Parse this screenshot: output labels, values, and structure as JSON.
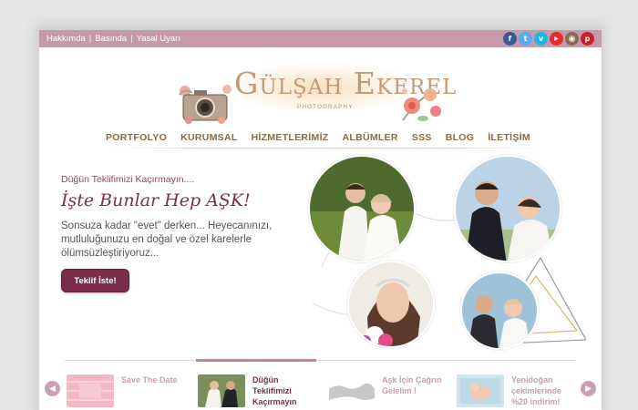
{
  "topbar": {
    "links": [
      "Hakkımda",
      "Basında",
      "Yasal Uyarı"
    ],
    "separator": "|",
    "socials": [
      {
        "name": "facebook-icon",
        "glyph": "f",
        "color": "#3b5998"
      },
      {
        "name": "twitter-icon",
        "glyph": "t",
        "color": "#55acee"
      },
      {
        "name": "vimeo-icon",
        "glyph": "v",
        "color": "#1ab7ea"
      },
      {
        "name": "youtube-icon",
        "glyph": "▶",
        "color": "#e52d27"
      },
      {
        "name": "instagram-icon",
        "glyph": "◉",
        "color": "#8a6a4f"
      },
      {
        "name": "pinterest-icon",
        "glyph": "p",
        "color": "#cb2027"
      }
    ]
  },
  "logo": {
    "title": "Gülşah Ekerel",
    "subtitle": "PHOTOGRAPHY"
  },
  "nav": [
    "PORTFOLYO",
    "KURUMSAL",
    "HİZMETLERİMİZ",
    "ALBÜMLER",
    "SSS",
    "BLOG",
    "İLETİŞİM"
  ],
  "hero": {
    "kicker": "Düğün Teklifimizi Kaçırmayın....",
    "title": "İşte Bunlar Hep AŞK!",
    "body": "Sonsuza kadar \"evet\" derken... Heyecanınızı, mutluluğunuzu en doğal ve özel karelerle ölümsüzleştiriyoruz...",
    "button": "Teklif İste!"
  },
  "slider": {
    "prev_icon": "chevron-left-icon",
    "next_icon": "chevron-right-icon",
    "items": [
      {
        "label": "Save The Date"
      },
      {
        "label": "Düğün Teklifimizi Kaçırmayın"
      },
      {
        "label": "Aşk İçin Çağrın Gelelim !"
      },
      {
        "label": "Yenidoğan çekimlerinde %20 indirim!"
      }
    ]
  },
  "colors": {
    "topbar": "#c69aab",
    "accent": "#7c2d4b",
    "nav_text": "#8e6a3a"
  }
}
